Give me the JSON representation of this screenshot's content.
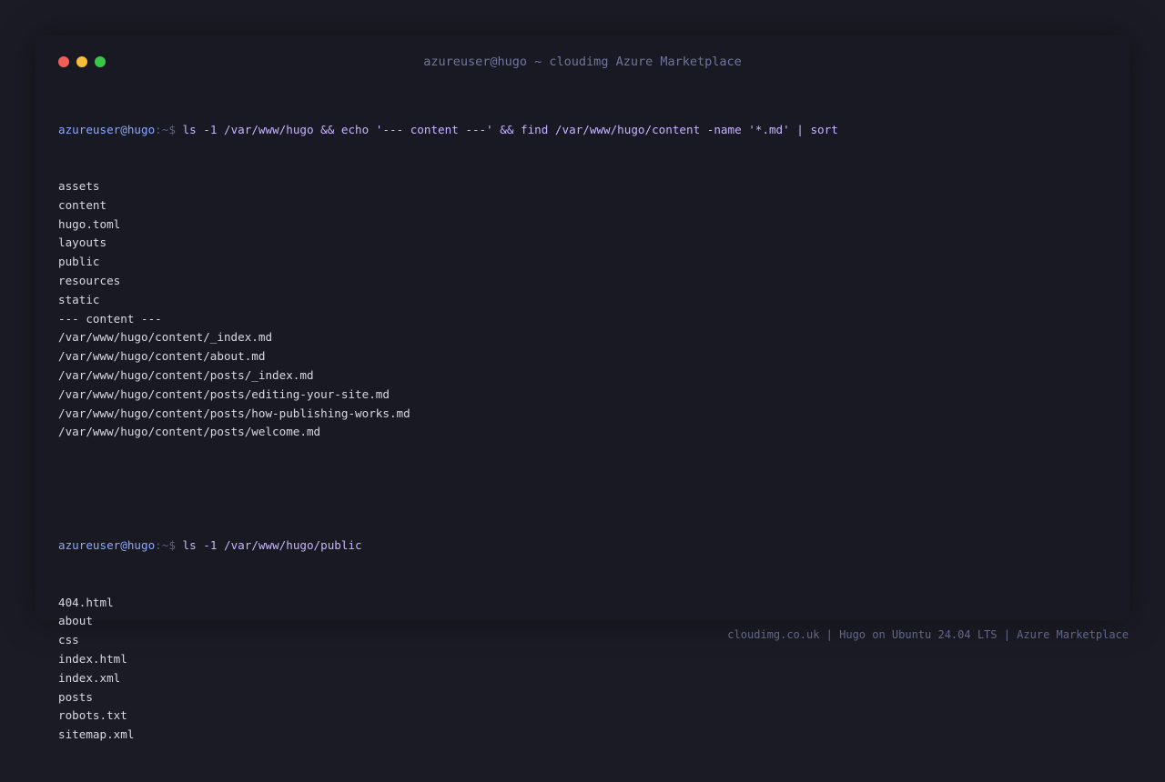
{
  "window": {
    "title": "azureuser@hugo ~ cloudimg Azure Marketplace"
  },
  "colors": {
    "close": "#f25f58",
    "minimize": "#f8bc3b",
    "maximize": "#3ac64a",
    "prompt_user": "#8aa8ff",
    "command": "#c9b4ff",
    "output": "#d6d9e4"
  },
  "terminal": {
    "block1": {
      "prompt_user": "azureuser@hugo",
      "prompt_sep": ":~$ ",
      "command": "ls -1 /var/www/hugo && echo '--- content ---' && find /var/www/hugo/content -name '*.md' | sort",
      "output": [
        "assets",
        "content",
        "hugo.toml",
        "layouts",
        "public",
        "resources",
        "static",
        "--- content ---",
        "/var/www/hugo/content/_index.md",
        "/var/www/hugo/content/about.md",
        "/var/www/hugo/content/posts/_index.md",
        "/var/www/hugo/content/posts/editing-your-site.md",
        "/var/www/hugo/content/posts/how-publishing-works.md",
        "/var/www/hugo/content/posts/welcome.md"
      ]
    },
    "block2": {
      "prompt_user": "azureuser@hugo",
      "prompt_sep": ":~$ ",
      "command": "ls -1 /var/www/hugo/public",
      "output": [
        "404.html",
        "about",
        "css",
        "index.html",
        "index.xml",
        "posts",
        "robots.txt",
        "sitemap.xml"
      ]
    }
  },
  "footer": {
    "text": "cloudimg.co.uk | Hugo on Ubuntu 24.04 LTS | Azure Marketplace"
  }
}
